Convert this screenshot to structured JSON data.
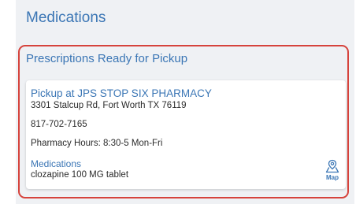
{
  "section": {
    "title": "Medications"
  },
  "ready": {
    "title": "Prescriptions Ready for Pickup",
    "card": {
      "pickup_label": "Pickup at JPS STOP SIX PHARMACY",
      "address": "3301 Stalcup Rd, Fort Worth TX 76119",
      "phone": "817-702-7165",
      "hours": "Pharmacy Hours: 8:30-5 Mon-Fri",
      "medications_label": "Medications",
      "medication": "clozapine 100 MG tablet",
      "map_label": "Map",
      "map_icon": "map-pin-icon"
    }
  },
  "colors": {
    "accent": "#3b76b5",
    "highlight_border": "#d6433c",
    "section_background": "#eff1f4"
  }
}
